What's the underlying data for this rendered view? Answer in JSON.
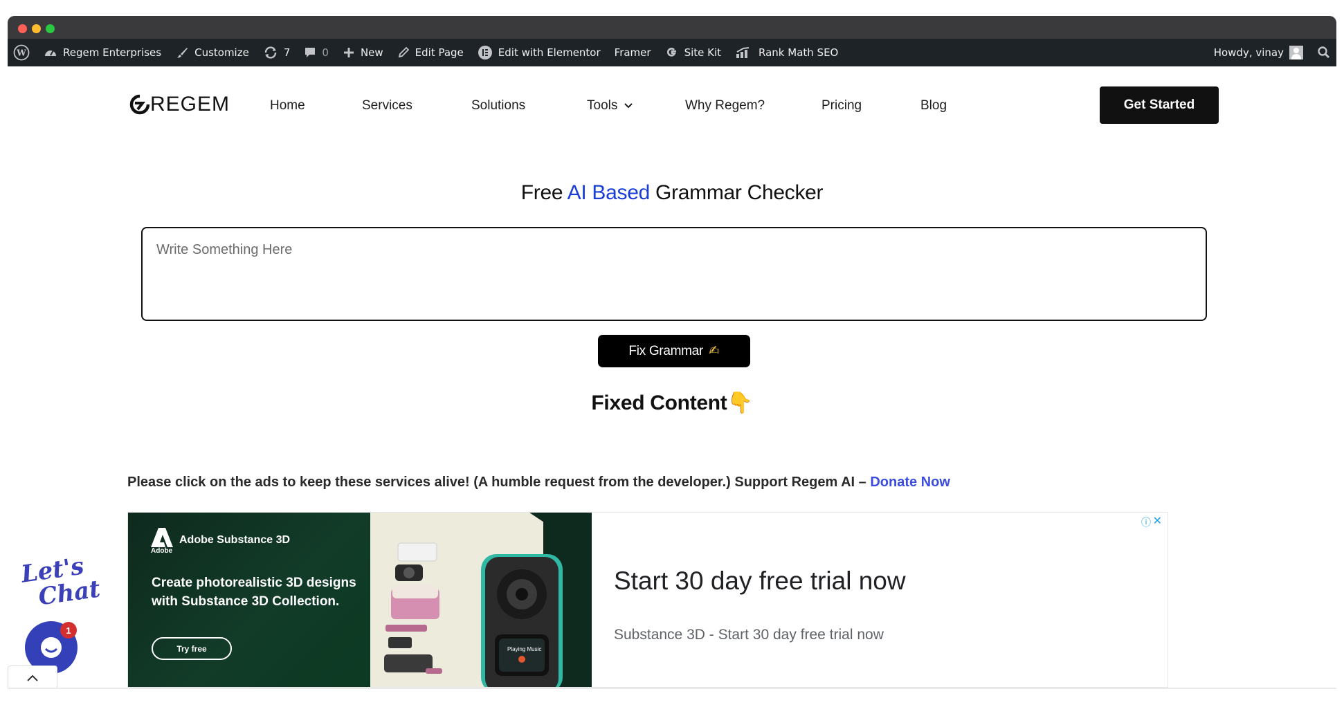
{
  "admin_bar": {
    "site_name": "Regem Enterprises",
    "customize": "Customize",
    "updates_count": "7",
    "comments_count": "0",
    "new": "New",
    "edit_page": "Edit Page",
    "edit_elementor": "Edit with Elementor",
    "framer": "Framer",
    "site_kit": "Site Kit",
    "rank_math": "Rank Math SEO",
    "howdy": "Howdy, vinay"
  },
  "header": {
    "logo_text": "REGEM",
    "nav": [
      {
        "label": "Home"
      },
      {
        "label": "Services"
      },
      {
        "label": "Solutions"
      },
      {
        "label": "Tools"
      },
      {
        "label": "Why Regem?"
      },
      {
        "label": "Pricing"
      },
      {
        "label": "Blog"
      }
    ],
    "cta": "Get Started"
  },
  "main": {
    "heading_prefix": "Free ",
    "heading_accent": "AI Based",
    "heading_suffix": " Grammar Checker",
    "input_placeholder": "Write Something Here",
    "fix_button": "Fix Grammar",
    "fix_emoji": "✍",
    "fixed_title": "Fixed Content",
    "fixed_emoji": "👇",
    "notice": "Please click on the ads to keep these services alive! (A humble request from the developer.) Support Regem AI – ",
    "donate": "Donate Now"
  },
  "ad": {
    "adobe_word": "Adobe",
    "brand": "Adobe Substance 3D",
    "copy": "Create photorealistic 3D designs with Substance 3D Collection.",
    "try_label": "Try free",
    "device_label": "Playing Music",
    "headline": "Start 30 day free trial now",
    "subtext": "Substance 3D - Start 30 day free trial now",
    "info": "ⓘ",
    "close": "✕"
  },
  "chat": {
    "lets": "Let's",
    "chat": "Chat",
    "badge": "1"
  },
  "colors": {
    "accent_blue": "#1a3dd9",
    "donate_link": "#3a4dde",
    "admin_bar_bg": "#1d2327",
    "chat_blue": "#3340b8"
  }
}
